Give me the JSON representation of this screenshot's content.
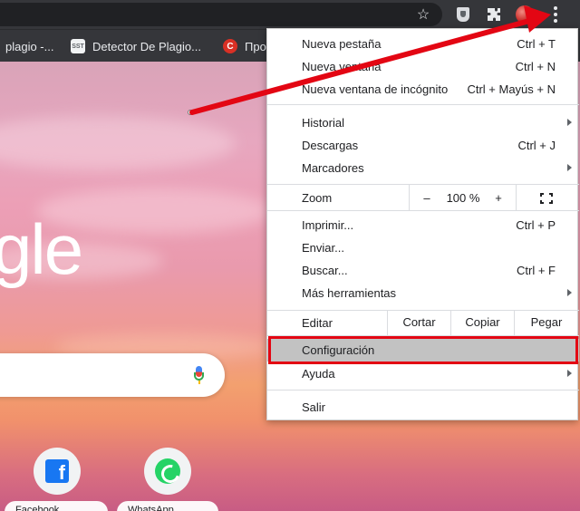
{
  "toolbar": {
    "star_icon": "star-icon",
    "extension_icon": "shield-extension-icon",
    "puzzle_icon": "puzzle-icon",
    "menu_icon": "three-dots-icon"
  },
  "bookmarks": [
    {
      "label": "plagio -...",
      "favicon": ""
    },
    {
      "label": "Detector De Plagio...",
      "favicon": "SST"
    },
    {
      "label": "Про",
      "favicon": "C"
    }
  ],
  "ntp": {
    "logo_text": "gle",
    "shortcuts": [
      {
        "label": "Facebook"
      },
      {
        "label": "WhatsApp"
      }
    ]
  },
  "menu": {
    "items_top": [
      {
        "label": "Nueva pestaña",
        "shortcut": "Ctrl + T"
      },
      {
        "label": "Nueva ventana",
        "shortcut": "Ctrl + N"
      },
      {
        "label": "Nueva ventana de incógnito",
        "shortcut": "Ctrl + Mayús + N"
      }
    ],
    "items_history": [
      {
        "label": "Historial"
      },
      {
        "label": "Descargas",
        "shortcut": "Ctrl + J"
      },
      {
        "label": "Marcadores"
      }
    ],
    "zoom": {
      "label": "Zoom",
      "minus": "–",
      "value": "100 %",
      "plus": "+"
    },
    "items_tools": [
      {
        "label": "Imprimir...",
        "shortcut": "Ctrl + P"
      },
      {
        "label": "Enviar..."
      },
      {
        "label": "Buscar...",
        "shortcut": "Ctrl + F"
      },
      {
        "label": "Más herramientas"
      }
    ],
    "edit": {
      "label": "Editar",
      "cut": "Cortar",
      "copy": "Copiar",
      "paste": "Pegar"
    },
    "settings": "Configuración",
    "help": "Ayuda",
    "exit": "Salir"
  },
  "colors": {
    "annotation_red": "#e30613",
    "highlight": "#c2c2c2"
  }
}
